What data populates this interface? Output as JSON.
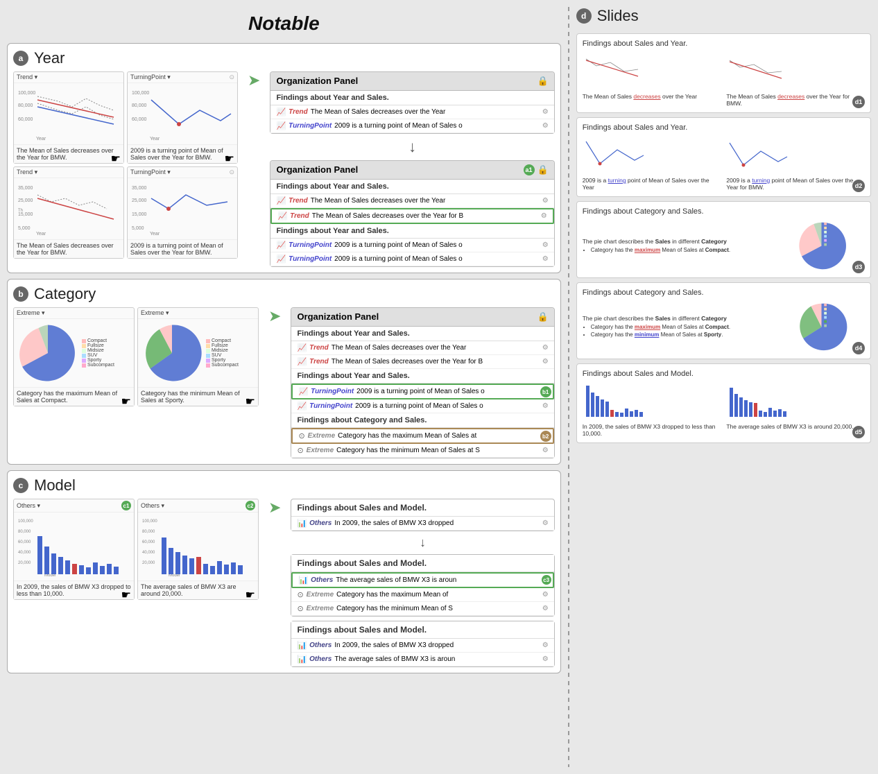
{
  "header": {
    "title": "Notable"
  },
  "sections": {
    "a": {
      "badge": "a",
      "title": "Year",
      "charts": [
        {
          "label": "Trend ▾",
          "caption": "The Mean of Sales decreases over the Year for BMW."
        },
        {
          "label": "TurningPoint ▾",
          "caption": "2009 is a turning point of Mean of Sales over the Year for BMW."
        },
        {
          "label": "Trend ▾",
          "caption": "The Mean of Sales decreases over the Year for BMW."
        },
        {
          "label": "TurningPoint ▾",
          "caption": "2009 is a turning point of Mean of Sales over the Year for BMW."
        }
      ],
      "panel1": {
        "header": "Organization Panel",
        "sections": [
          {
            "title": "Findings about Year and Sales.",
            "items": [
              {
                "type": "trend",
                "tag": "Trend",
                "text": "The Mean of Sales decreases over the Year"
              },
              {
                "type": "turning",
                "tag": "TurningPoint",
                "text": "2009 is a turning point of Mean of Sales o"
              }
            ]
          }
        ]
      },
      "panel2": {
        "header": "Organization Panel",
        "badge": "a1",
        "sections": [
          {
            "title": "Findings about Year and Sales.",
            "items": [
              {
                "type": "trend",
                "tag": "Trend",
                "text": "The Mean of Sales decreases over the Year",
                "highlighted": false
              },
              {
                "type": "trend",
                "tag": "Trend",
                "text": "The Mean of Sales decreases over the Year for B",
                "highlighted": true
              }
            ]
          },
          {
            "title": "Findings about Year and Sales.",
            "items": [
              {
                "type": "turning",
                "tag": "TurningPoint",
                "text": "2009 is a turning point of Mean of Sales o",
                "highlighted": false
              },
              {
                "type": "turning",
                "tag": "TurningPoint",
                "text": "2009 is a turning point of Mean of Sales o",
                "highlighted": false
              }
            ]
          }
        ]
      }
    },
    "b": {
      "badge": "b",
      "title": "Category",
      "panel": {
        "header": "Organization Panel",
        "sections": [
          {
            "title": "Findings about Year and Sales.",
            "items": [
              {
                "type": "trend",
                "tag": "Trend",
                "text": "The Mean of Sales decreases over the Year"
              },
              {
                "type": "trend",
                "tag": "Trend",
                "text": "The Mean of Sales decreases over the Year for B"
              }
            ]
          },
          {
            "title": "Findings about Year and Sales.",
            "items": [
              {
                "type": "turning",
                "tag": "TurningPoint",
                "text": "2009 is a turning point of Mean of Sales o",
                "badge": "b1"
              },
              {
                "type": "turning",
                "tag": "TurningPoint",
                "text": "2009 is a turning point of Mean of Sales o"
              }
            ]
          },
          {
            "title": "Findings about Category and Sales.",
            "items": [
              {
                "type": "extreme",
                "tag": "Extreme",
                "text": "Category has the maximum Mean of Sales at",
                "badge": "b2"
              },
              {
                "type": "extreme",
                "tag": "Extreme",
                "text": "Category has the minimum Mean of Sales at S"
              }
            ]
          }
        ]
      },
      "captions": [
        "Category has the maximum Mean of Sales at Compact.",
        "Category has the minimum Mean of Sales at Sporty."
      ]
    },
    "c": {
      "badge": "c",
      "title": "Model",
      "panel1": {
        "title": "Findings about Sales and Model.",
        "items": [
          {
            "type": "others",
            "tag": "Others",
            "text": "In 2009, the sales of BMW X3 dropped"
          }
        ]
      },
      "panel2": {
        "title": "Findings about Sales and Model.",
        "badge": "c3",
        "items": [
          {
            "type": "others",
            "tag": "Others",
            "text": "The average sales of BMW X3 is aroun"
          },
          {
            "type": "extreme",
            "tag": "Extreme",
            "text": "Category has the maximum Mean of"
          },
          {
            "type": "extreme",
            "tag": "Extreme",
            "text": "Category has the minimum Mean of S"
          }
        ]
      },
      "panel3": {
        "title": "Findings about Sales and Model.",
        "items": [
          {
            "type": "others",
            "tag": "Others",
            "text": "In 2009, the sales of BMW X3 dropped"
          },
          {
            "type": "others",
            "tag": "Others",
            "text": "The average sales of BMW X3 is aroun"
          }
        ]
      },
      "charts": [
        {
          "label": "Others ▾",
          "badge": "c1",
          "caption": "In 2009, the sales of BMW X3 dropped to less than 10,000."
        },
        {
          "label": "Others ▾",
          "badge": "c2",
          "caption": "The average sales of BMW X3 are around 20,000."
        }
      ]
    }
  },
  "slides": {
    "badge": "d",
    "title": "Slides",
    "items": [
      {
        "id": "d1",
        "title": "Findings about Sales and Year.",
        "captions": [
          "The Mean of Sales decreases over the Year",
          "The Mean of Sales decreases over the Year for BMW."
        ],
        "highlight_word": "decreases"
      },
      {
        "id": "d2",
        "title": "Findings about Sales and Year.",
        "captions": [
          "2009 is a turning point of Mean of Sales over the Year",
          "2009 is a turning point of Mean of Sales over the Year for BMW."
        ],
        "highlight_word": "turning"
      },
      {
        "id": "d3",
        "title": "Findings about Category and Sales.",
        "bullet_title": "The pie chart describes the Sales in different Category",
        "bullets": [
          "Category has the maximum Mean of Sales at Compact.",
          ""
        ],
        "highlight_word": "maximum"
      },
      {
        "id": "d4",
        "title": "Findings about Category and Sales.",
        "bullet_title": "The pie chart describes the Sales in different Category",
        "bullets": [
          "Category has the maximum Mean of Sales at Compact.",
          "Category has the minimum Mean of Sales at Sporty."
        ],
        "highlight_words": [
          "maximum",
          "minimum"
        ]
      },
      {
        "id": "d5",
        "title": "Findings about Sales and Model.",
        "captions": [
          "In 2009, the sales of BMW X3 dropped to less than 10,000.",
          "The average sales of BMW X3 is around 20,000."
        ]
      }
    ]
  }
}
